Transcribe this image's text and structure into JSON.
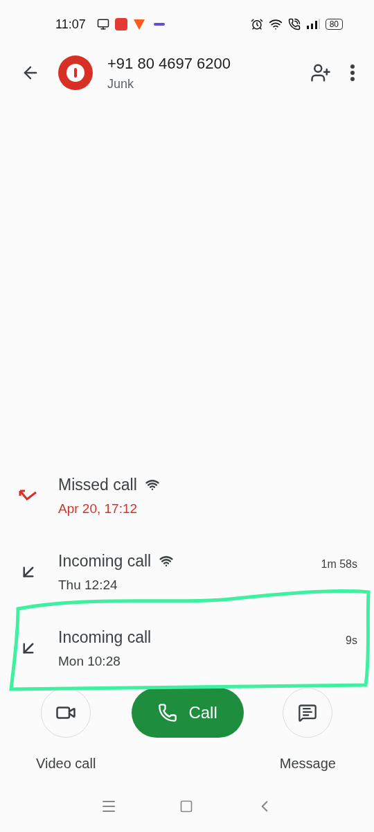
{
  "status_bar": {
    "time": "11:07",
    "battery": "80"
  },
  "header": {
    "title": "+91 80 4697 6200",
    "subtitle": "Junk"
  },
  "calls": [
    {
      "kind": "missed",
      "label": "Missed call",
      "time": "Apr 20, 17:12",
      "wifi": true
    },
    {
      "kind": "incoming",
      "label": "Incoming call",
      "time": "Thu 12:24",
      "wifi": true,
      "duration": "1m 58s"
    },
    {
      "kind": "incoming",
      "label": "Incoming call",
      "time": "Mon 10:28",
      "wifi": false,
      "duration": "9s"
    }
  ],
  "actions": {
    "video": "Video call",
    "call": "Call",
    "message": "Message"
  }
}
